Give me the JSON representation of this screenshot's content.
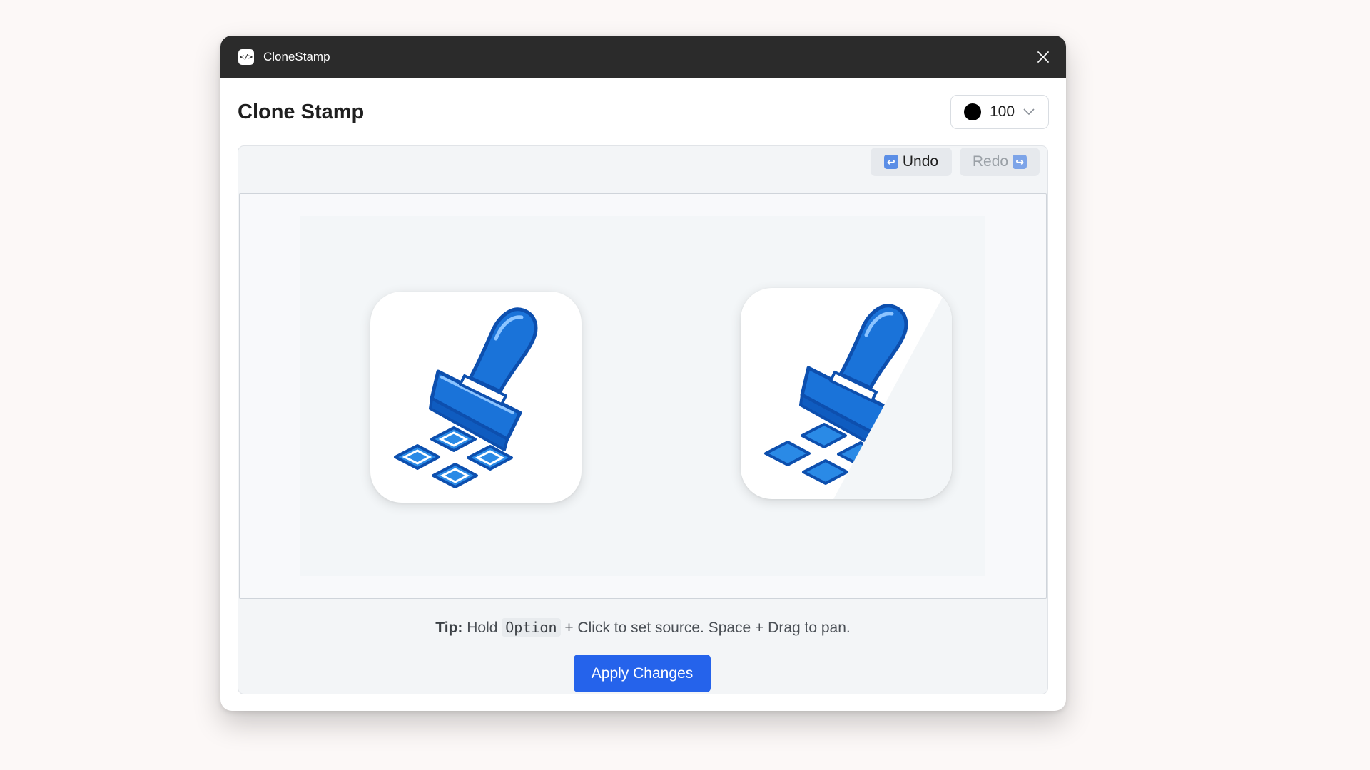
{
  "window": {
    "app_title": "CloneStamp",
    "app_icon": "code-icon"
  },
  "header": {
    "title": "Clone Stamp",
    "brush_size": "100",
    "brush_color": "#000000"
  },
  "toolbar": {
    "undo_label": "Undo",
    "redo_label": "Redo",
    "undo_icon": "↩",
    "redo_icon": "↪"
  },
  "canvas": {
    "images": [
      "clone-stamp-icon",
      "clone-stamp-icon-partially-erased"
    ]
  },
  "tip": {
    "prefix": "Tip:",
    "hold": "Hold",
    "key": "Option",
    "rest": "+ Click to set source. Space + Drag to pan."
  },
  "actions": {
    "apply_label": "Apply Changes"
  },
  "colors": {
    "titlebar": "#2b2b2b",
    "primary": "#2563eb",
    "stamp_blue": "#1a73d9"
  }
}
